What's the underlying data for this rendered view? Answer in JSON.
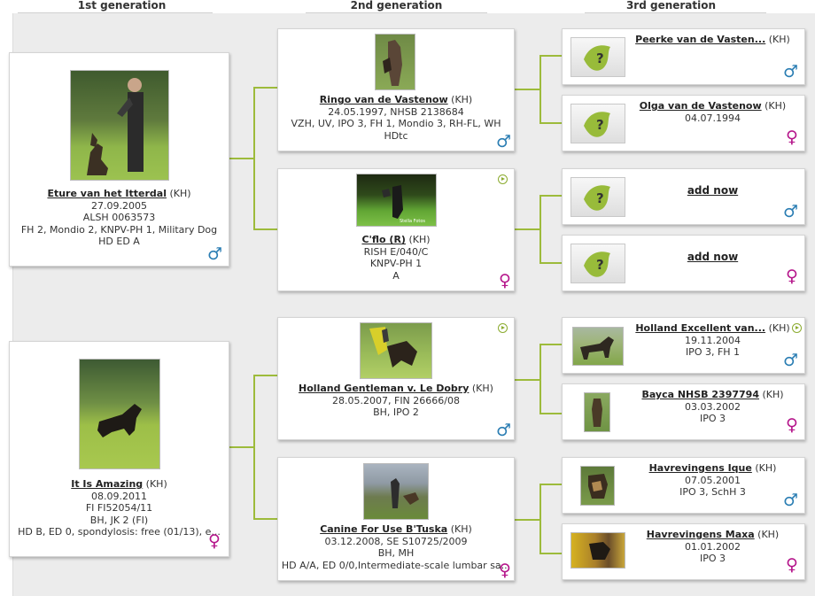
{
  "headers": {
    "g1": "1st generation",
    "g2": "2nd generation",
    "g3": "3rd generation"
  },
  "g1": [
    {
      "name": "Eture van het Itterdal",
      "kh": "(KH)",
      "lines": [
        "27.09.2005",
        "ALSH 0063573",
        "FH 2, Mondio 2, KNPV-PH 1, Military Dog",
        "HD ED A"
      ],
      "sex": "♂"
    },
    {
      "name": "It Is Amazing",
      "kh": "(KH)",
      "lines": [
        "08.09.2011",
        "FI FI52054/11",
        "BH, JK 2 (FI)",
        "HD B, ED 0, spondylosis: free (01/13), e..."
      ],
      "sex": "♀"
    }
  ],
  "g2": [
    {
      "name": "Ringo van de Vastenow",
      "kh": "(KH)",
      "lines": [
        "24.05.1997, NHSB 2138684",
        "VZH, UV, IPO 3, FH 1, Mondio 3, RH-FL, WH",
        "HDtc"
      ],
      "sex": "♂"
    },
    {
      "name": "C'flo (R)",
      "kh": "(KH)",
      "lines": [
        "RISH E/040/C",
        "KNPV-PH 1",
        "A"
      ],
      "sex": "♀",
      "photo_caption": "Stella Fotos"
    },
    {
      "name": "Holland Gentleman v. Le Dobry",
      "kh": "(KH)",
      "lines": [
        "28.05.2007, FIN 26666/08",
        "BH, IPO 2"
      ],
      "sex": "♂"
    },
    {
      "name": "Canine For Use B'Tuska",
      "kh": "(KH)",
      "lines": [
        "03.12.2008, SE S10725/2009",
        "BH, MH",
        "HD A/A, ED 0/0,Intermediate-scale lumbar sa..."
      ],
      "sex": "♀"
    }
  ],
  "g3": [
    {
      "name": "Peerke van de Vasten...",
      "kh": "(KH)",
      "lines": [],
      "sex": "♂"
    },
    {
      "name": "Olga van de Vastenow",
      "kh": "(KH)",
      "lines": [
        "04.07.1994"
      ],
      "sex": "♀"
    },
    {
      "add": "add now",
      "sex": "♂"
    },
    {
      "add": "add now",
      "sex": "♀"
    },
    {
      "name": "Holland Excellent van...",
      "kh": "(KH)",
      "lines": [
        "19.11.2004",
        "IPO 3, FH 1"
      ],
      "sex": "♂"
    },
    {
      "name": "Bayca NHSB 2397794",
      "kh": "(KH)",
      "lines": [
        "03.03.2002",
        "IPO 3"
      ],
      "sex": "♀"
    },
    {
      "name": "Havrevingens Ique",
      "kh": "(KH)",
      "lines": [
        "07.05.2001",
        "IPO 3, SchH 3"
      ],
      "sex": "♂"
    },
    {
      "name": "Havrevingens Maxa",
      "kh": "(KH)",
      "lines": [
        "01.01.2002",
        "IPO 3"
      ],
      "sex": "♀"
    }
  ],
  "colors": {
    "connector": "#9dbb3b",
    "male": "#2a7db3",
    "female": "#b5168b",
    "background": "#ececec"
  }
}
